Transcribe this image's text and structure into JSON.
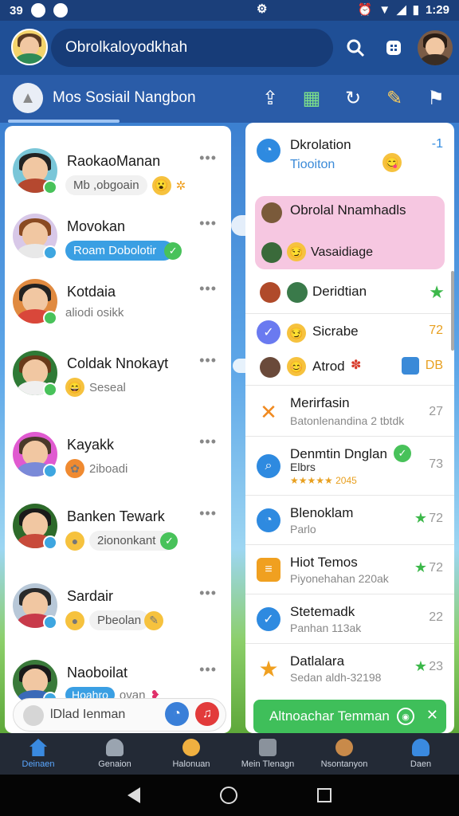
{
  "status_bar": {
    "left_text": "39",
    "time": "1:29"
  },
  "top_bar": {
    "search_text": "Obrolkaloyodkhah"
  },
  "group_bar": {
    "title": "Mos Sosiail Nangbon"
  },
  "contacts": [
    {
      "name": "RaokaoManan",
      "sub": "Mb ,obgoain"
    },
    {
      "name": "Movokan",
      "sub": "Roam Dobolotir"
    },
    {
      "name": "Kotdaia",
      "sub": "aliodi osikk"
    },
    {
      "name": "Coldak Nnokayt",
      "sub": "Seseal"
    },
    {
      "name": "Kayakk",
      "sub": "2iboadi"
    },
    {
      "name": "Banken Tewark",
      "sub": "2iononkant"
    },
    {
      "name": "Sardair",
      "sub": "Pbeolan"
    },
    {
      "name": "Naoboilat",
      "sub": "Hoahro",
      "extra": "ovan"
    }
  ],
  "compose": {
    "text": "lDlad Ienman"
  },
  "right_items": [
    {
      "title": "Dkrolation",
      "sub": "Tiooiton",
      "num": "-1"
    },
    {
      "title": "Obrolal Nnamhadls",
      "sub": "Vasaidiage"
    },
    {
      "title": "Deridtian"
    },
    {
      "title": "Sicrabe",
      "num": "72"
    },
    {
      "title": "Atrod",
      "num": "DB"
    },
    {
      "title": "Merirfasin",
      "sub": "Batonlenandina 2 tbtdk",
      "num": "27"
    },
    {
      "title": "Denmtin Dnglan",
      "sub": "Elbrs",
      "rating": "2045",
      "num": "73"
    },
    {
      "title": "Blenoklam",
      "sub": "Parlo",
      "num": "72"
    },
    {
      "title": "Hiot Temos",
      "sub": "Piyonehahan 220ak",
      "num": "72"
    },
    {
      "title": "Stetemadk",
      "sub": "Panhan 113ak",
      "num": "22"
    },
    {
      "title": "Datlalara",
      "sub": "Sedan aldh-32198",
      "num": "23"
    }
  ],
  "green_bar": {
    "label": "Altnoachar Temman"
  },
  "bottom_nav": [
    {
      "label": "Deinaen",
      "icon": "home-icon"
    },
    {
      "label": "Genaion",
      "icon": "people-icon"
    },
    {
      "label": "Halonuan",
      "icon": "profile-icon"
    },
    {
      "label": "Mein Tlenagn",
      "icon": "document-icon"
    },
    {
      "label": "Nsontanyon",
      "icon": "game-icon"
    },
    {
      "label": "Daen",
      "icon": "user-icon"
    }
  ],
  "colors": {
    "appbar": "#1f4f96",
    "accent_blue": "#3a9fe3",
    "accent_green": "#3fbf5a",
    "highlight_pink": "#f6c7e1"
  }
}
